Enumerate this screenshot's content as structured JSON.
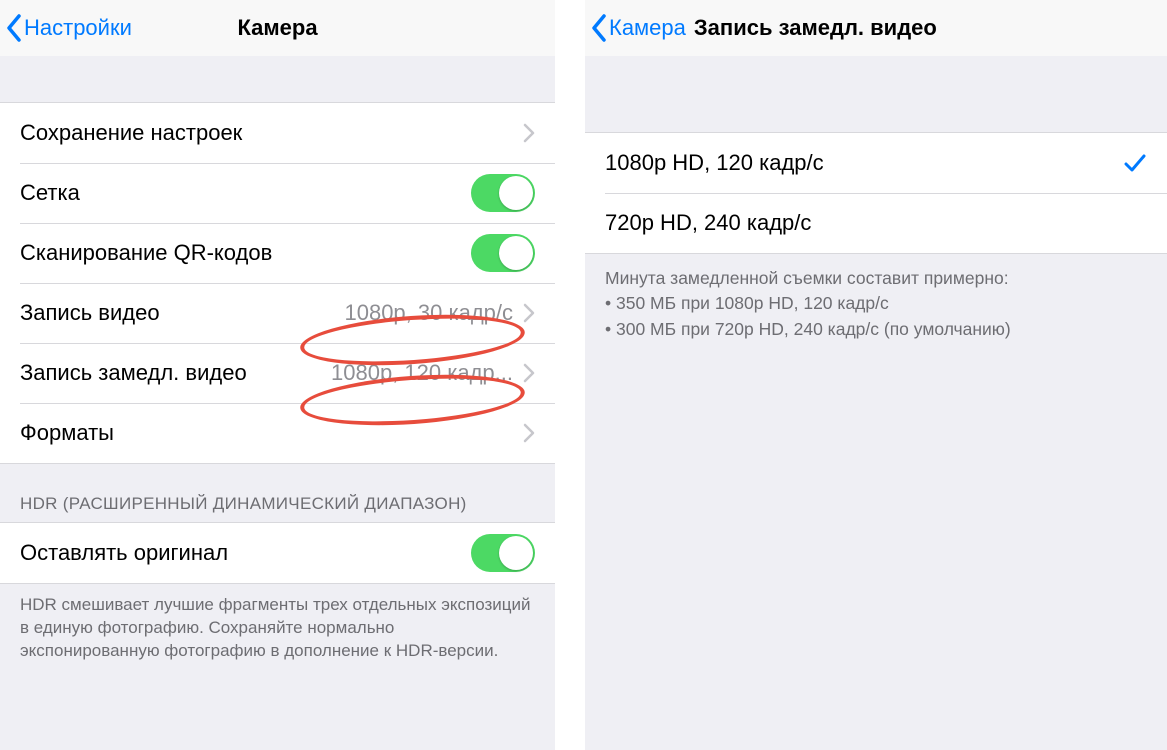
{
  "left": {
    "back_label": "Настройки",
    "title": "Камера",
    "rows": {
      "save_settings": "Сохранение настроек",
      "grid": "Сетка",
      "qr": "Сканирование QR-кодов",
      "video_record": "Запись видео",
      "video_record_detail": "1080p, 30 кадр/с",
      "slomo_record": "Запись замедл. видео",
      "slomo_record_detail": "1080p, 120 кадр...",
      "formats": "Форматы",
      "hdr_header": "HDR (РАСШИРЕННЫЙ ДИНАМИЧЕСКИЙ ДИАПАЗОН)",
      "keep_original": "Оставлять оригинал",
      "hdr_footer": "HDR смешивает лучшие фрагменты трех отдельных экспозиций в единую фотографию. Сохраняйте нормально экспонированную фотографию в дополнение к HDR-версии."
    },
    "toggles": {
      "grid": true,
      "qr": true,
      "keep_original": true
    }
  },
  "right": {
    "back_label": "Камера",
    "title": "Запись замедл. видео",
    "options": [
      {
        "label": "1080p HD, 120 кадр/с",
        "selected": true
      },
      {
        "label": "720p HD, 240 кадр/с",
        "selected": false
      }
    ],
    "footnote_title": "Минута замедленной съемки составит примерно:",
    "footnote_1": "• 350 МБ при 1080p HD, 120 кадр/с",
    "footnote_2": "• 300 МБ при 720p HD, 240 кадр/с (по умолчанию)"
  }
}
